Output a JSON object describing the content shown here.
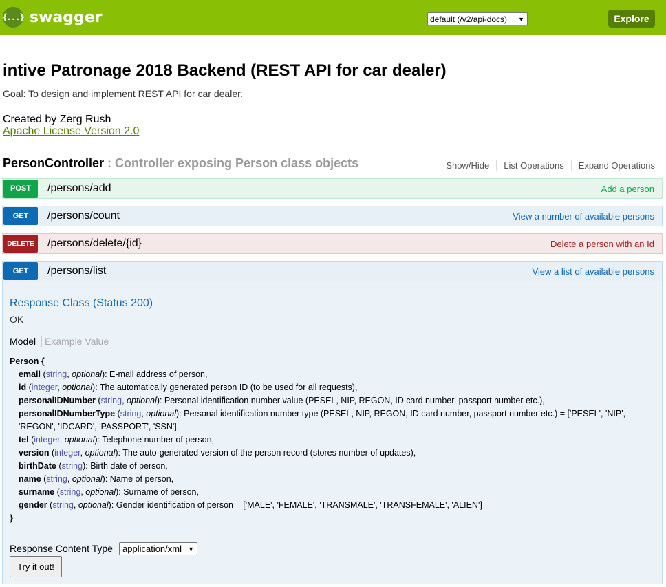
{
  "header": {
    "logo_icon": "{...}",
    "logo_text": "swagger",
    "spec_select_value": "default (/v2/api-docs)",
    "explore_label": "Explore",
    "brand_color": "#89bf04"
  },
  "info": {
    "title": "intive Patronage 2018 Backend (REST API for car dealer)",
    "description": "Goal: To design and implement REST API for car dealer.",
    "author": "Created by Zerg Rush",
    "license": "Apache License Version 2.0"
  },
  "controller": {
    "name": "PersonController",
    "separator": " : ",
    "description": "Controller exposing Person class objects",
    "actions": [
      "Show/Hide",
      "List Operations",
      "Expand Operations"
    ]
  },
  "operations": [
    {
      "method": "POST",
      "path": "/persons/add",
      "summary": "Add a person",
      "color": "#10a54a"
    },
    {
      "method": "GET",
      "path": "/persons/count",
      "summary": "View a number of available persons",
      "color": "#0f6ab4"
    },
    {
      "method": "DELETE",
      "path": "/persons/delete/{id}",
      "summary": "Delete a person with an Id",
      "color": "#a41e22"
    },
    {
      "method": "GET",
      "path": "/persons/list",
      "summary": "View a list of available persons",
      "color": "#0f6ab4"
    }
  ],
  "expanded": {
    "response_class_title": "Response Class (Status 200)",
    "response_status": "OK",
    "tab_model": "Model",
    "tab_example": "Example Value",
    "model_name": "Person {",
    "model_close": "}",
    "properties": [
      {
        "name": "email",
        "type": "string",
        "opt": "optional",
        "desc": "E-mail address of person,"
      },
      {
        "name": "id",
        "type": "integer",
        "opt": "optional",
        "desc": "The automatically generated person ID (to be used for all requests),"
      },
      {
        "name": "personalIDNumber",
        "type": "string",
        "opt": "optional",
        "desc": "Personal identification number value (PESEL, NIP, REGON, ID card number, passport number etc.),"
      },
      {
        "name": "personalIDNumberType",
        "type": "string",
        "opt": "optional",
        "desc": "Personal identification number type (PESEL, NIP, REGON, ID card number, passport number etc.) = ['PESEL', 'NIP', 'REGON', 'IDCARD', 'PASSPORT', 'SSN'],"
      },
      {
        "name": "tel",
        "type": "integer",
        "opt": "optional",
        "desc": "Telephone number of person,"
      },
      {
        "name": "version",
        "type": "integer",
        "opt": "optional",
        "desc": "The auto-generated version of the person record (stores number of updates),"
      },
      {
        "name": "birthDate",
        "type": "string",
        "opt": "",
        "desc": "Birth date of person,"
      },
      {
        "name": "name",
        "type": "string",
        "opt": "optional",
        "desc": "Name of person,"
      },
      {
        "name": "surname",
        "type": "string",
        "opt": "optional",
        "desc": "Surname of person,"
      },
      {
        "name": "gender",
        "type": "string",
        "opt": "optional",
        "desc": "Gender identification of person = ['MALE', 'FEMALE', 'TRANSMALE', 'TRANSFEMALE', 'ALIEN']"
      }
    ],
    "response_content_type_label": "Response Content Type",
    "response_content_type_value": "application/xml",
    "try_button": "Try it out!"
  }
}
